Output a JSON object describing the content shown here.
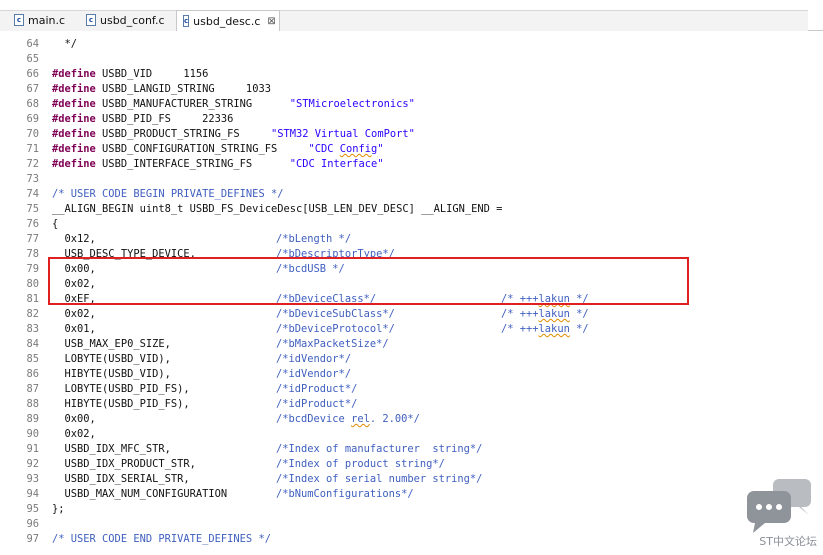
{
  "tabs": [
    {
      "label": "main.c",
      "icon": "c-file-icon"
    },
    {
      "label": "usbd_conf.c",
      "icon": "c-file-icon"
    },
    {
      "label": "usbd_desc.c",
      "icon": "c-file-icon",
      "active": true,
      "close": "⊠"
    }
  ],
  "lines": [
    {
      "n": "64",
      "code": "  */",
      "ccol": ""
    },
    {
      "n": "65",
      "code": ""
    },
    {
      "n": "66",
      "kw": "#define",
      "code": " USBD_VID     1156"
    },
    {
      "n": "67",
      "kw": "#define",
      "code": " USBD_LANGID_STRING     1033"
    },
    {
      "n": "68",
      "kw": "#define",
      "code": " USBD_MANUFACTURER_STRING      ",
      "str": "\"STMicroelectronics\""
    },
    {
      "n": "69",
      "kw": "#define",
      "code": " USBD_PID_FS     22336"
    },
    {
      "n": "70",
      "kw": "#define",
      "code": " USBD_PRODUCT_STRING_FS     ",
      "str": "\"STM32 Virtual ComPort\""
    },
    {
      "n": "71",
      "kw": "#define",
      "code": " USBD_CONFIGURATION_STRING_FS     ",
      "str": "\"CDC Config\""
    },
    {
      "n": "72",
      "kw": "#define",
      "code": " USBD_INTERFACE_STRING_FS      ",
      "str": "\"CDC Interface\""
    },
    {
      "n": "73",
      "code": ""
    },
    {
      "n": "74",
      "comment": "/* USER CODE BEGIN PRIVATE_DEFINES */"
    },
    {
      "n": "75",
      "code": "__ALIGN_BEGIN uint8_t USBD_FS_DeviceDesc[USB_LEN_DEV_DESC] __ALIGN_END ="
    },
    {
      "n": "76",
      "code": "{"
    },
    {
      "n": "77",
      "code": "  0x12,",
      "c1": "/*bLength */"
    },
    {
      "n": "78",
      "code": "  USB_DESC_TYPE_DEVICE,",
      "c1": "/*bDescriptorType*/"
    },
    {
      "n": "79",
      "code": "  0x00,",
      "c1": "/*bcdUSB */"
    },
    {
      "n": "80",
      "code": "  0x02,"
    },
    {
      "n": "81",
      "code": "  0xEF,",
      "c1": "/*bDeviceClass*/",
      "c2": "/* +++lakun */"
    },
    {
      "n": "82",
      "code": "  0x02,",
      "c1": "/*bDeviceSubClass*/",
      "c2": "/* +++lakun */"
    },
    {
      "n": "83",
      "code": "  0x01,",
      "c1": "/*bDeviceProtocol*/",
      "c2": "/* +++lakun */"
    },
    {
      "n": "84",
      "code": "  USB_MAX_EP0_SIZE,",
      "c1": "/*bMaxPacketSize*/"
    },
    {
      "n": "85",
      "code": "  LOBYTE(USBD_VID),",
      "c1": "/*idVendor*/"
    },
    {
      "n": "86",
      "code": "  HIBYTE(USBD_VID),",
      "c1": "/*idVendor*/"
    },
    {
      "n": "87",
      "code": "  LOBYTE(USBD_PID_FS),",
      "c1": "/*idProduct*/"
    },
    {
      "n": "88",
      "code": "  HIBYTE(USBD_PID_FS),",
      "c1": "/*idProduct*/"
    },
    {
      "n": "89",
      "code": "  0x00,",
      "c1": "/*bcdDevice rel. 2.00*/"
    },
    {
      "n": "90",
      "code": "  0x02,"
    },
    {
      "n": "91",
      "code": "  USBD_IDX_MFC_STR,",
      "c1": "/*Index of manufacturer  string*/"
    },
    {
      "n": "92",
      "code": "  USBD_IDX_PRODUCT_STR,",
      "c1": "/*Index of product string*/"
    },
    {
      "n": "93",
      "code": "  USBD_IDX_SERIAL_STR,",
      "c1": "/*Index of serial number string*/"
    },
    {
      "n": "94",
      "code": "  USBD_MAX_NUM_CONFIGURATION",
      "c1": "/*bNumConfigurations*/"
    },
    {
      "n": "95",
      "code": "};"
    },
    {
      "n": "96",
      "code": ""
    },
    {
      "n": "97",
      "comment": "/* USER CODE END PRIVATE_DEFINES */"
    }
  ],
  "watermark": {
    "text": "ST中文论坛",
    "icon": "chat-bubbles-icon"
  },
  "colors": {
    "highlight_box": "#e02020",
    "keyword": "#7f0055",
    "string": "#2a00ff",
    "comment": "#3f5fbf"
  }
}
